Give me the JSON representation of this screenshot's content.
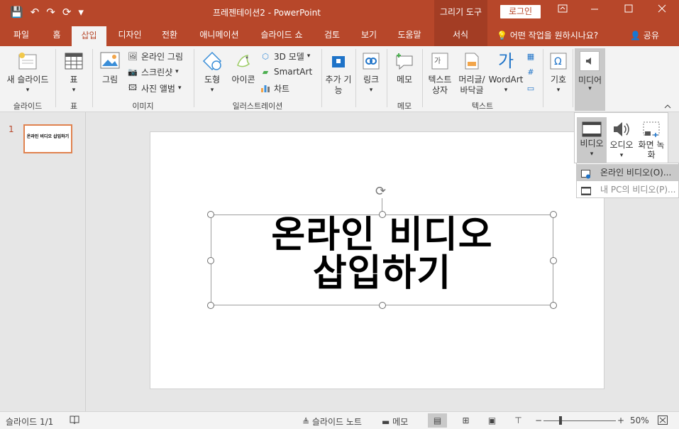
{
  "titlebar": {
    "title": "프레젠테이션2 - PowerPoint",
    "context_tab": "그리기 도구",
    "login": "로그인",
    "qat": [
      "💾",
      "↶",
      "↷",
      "⟳",
      "▾"
    ]
  },
  "tabs": [
    "파일",
    "홈",
    "삽입",
    "디자인",
    "전환",
    "애니메이션",
    "슬라이드 쇼",
    "검토",
    "보기",
    "도움말",
    "서식"
  ],
  "help_text": "어떤 작업을 원하시나요?",
  "share": "공유",
  "ribbon": {
    "slides": {
      "new_slide": "새 슬라이드",
      "label": "슬라이드"
    },
    "table": {
      "btn": "표",
      "label": "표"
    },
    "images": {
      "picture": "그림",
      "online": "온라인 그림",
      "screenshot": "스크린샷",
      "album": "사진 앨범",
      "label": "이미지"
    },
    "illustrations": {
      "shapes": "도형",
      "icons": "아이콘",
      "model": "3D 모델",
      "smartart": "SmartArt",
      "chart": "차트",
      "label": "일러스트레이션"
    },
    "addins": {
      "btn": "추가 기능"
    },
    "links": {
      "btn": "링크"
    },
    "comments": {
      "btn": "메모",
      "label": "메모"
    },
    "text": {
      "textbox": "텍스트 상자",
      "header": "머리글/ 바닥글",
      "wordart": "WordArt",
      "label": "텍스트"
    },
    "symbols": {
      "btn": "기호"
    },
    "media": {
      "btn": "미디어"
    }
  },
  "media_dropdown": {
    "video": "비디오",
    "audio": "오디오",
    "screen": "화면 녹화"
  },
  "video_menu": {
    "online": "온라인 비디오(O)...",
    "pc": "내 PC의 비디오(P)..."
  },
  "slide": {
    "number": "1",
    "thumb_text": "온라인 비디오 삽입하기",
    "line1": "온라인 비디오",
    "line2": "삽입하기"
  },
  "status": {
    "slide_count": "슬라이드 1/1",
    "notes": "슬라이드 노트",
    "comments": "메모",
    "zoom": "50%"
  },
  "colors": {
    "accent": "#b7472a",
    "ribbon_bg": "#f3f3f3",
    "highlight": "#c9c9c9"
  }
}
